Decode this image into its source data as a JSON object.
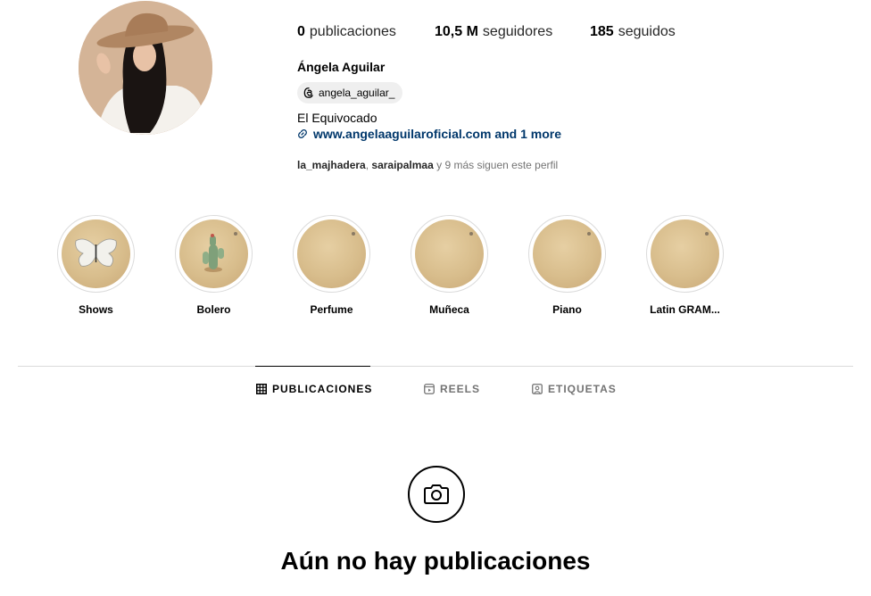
{
  "profile": {
    "name": "Ángela Aguilar",
    "threads_handle": "angela_aguilar_",
    "bio": "El Equivocado",
    "link_text": "www.angelaaguilaroficial.com and 1 more"
  },
  "stats": {
    "posts_value": "0",
    "posts_label": "publicaciones",
    "followers_value": "10,5 M",
    "followers_label": "seguidores",
    "following_value": "185",
    "following_label": "seguidos"
  },
  "followed_by": {
    "user1": "la_majhadera",
    "sep": ", ",
    "user2": "saraipalmaa",
    "suffix": " y 9 más siguen este perfil"
  },
  "highlights": [
    {
      "label": "Shows",
      "icon": "butterfly-icon"
    },
    {
      "label": "Bolero",
      "icon": "cactus-icon"
    },
    {
      "label": "Perfume",
      "icon": "blank-cover"
    },
    {
      "label": "Muñeca",
      "icon": "blank-cover"
    },
    {
      "label": "Piano",
      "icon": "blank-cover"
    },
    {
      "label": "Latin GRAM...",
      "icon": "blank-cover"
    }
  ],
  "tabs": {
    "posts": "PUBLICACIONES",
    "reels": "REELS",
    "tagged": "ETIQUETAS"
  },
  "empty_state": {
    "icon": "camera-icon",
    "title": "Aún no hay publicaciones"
  },
  "colors": {
    "link": "#00376b",
    "secondary_text": "#737373",
    "divider": "#dbdbdb"
  }
}
